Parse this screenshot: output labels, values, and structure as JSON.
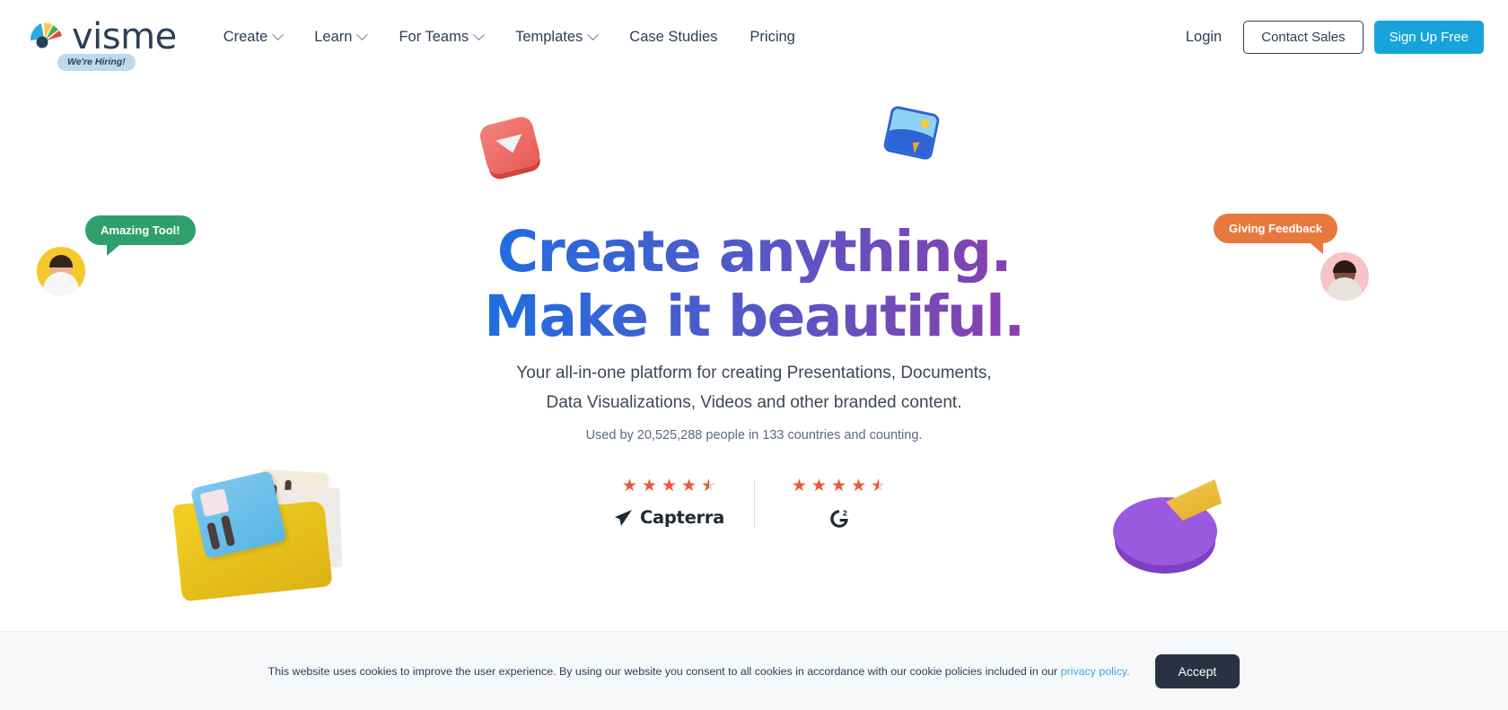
{
  "header": {
    "logo_text": "visme",
    "hiring_badge": "We're Hiring!",
    "nav": [
      {
        "label": "Create",
        "has_dropdown": true
      },
      {
        "label": "Learn",
        "has_dropdown": true
      },
      {
        "label": "For Teams",
        "has_dropdown": true
      },
      {
        "label": "Templates",
        "has_dropdown": true
      },
      {
        "label": "Case Studies",
        "has_dropdown": false
      },
      {
        "label": "Pricing",
        "has_dropdown": false
      }
    ],
    "login_label": "Login",
    "contact_sales_label": "Contact Sales",
    "signup_label": "Sign Up Free",
    "primary_color": "#17A4DC"
  },
  "hero": {
    "headline_line1": "Create anything.",
    "headline_line2": "Make it beautiful.",
    "subtitle_line1": "Your all-in-one platform for creating Presentations, Documents,",
    "subtitle_line2": "Data Visualizations, Videos and other branded content.",
    "used_by": "Used by 20,525,288 people in 133 countries and counting.",
    "gradient_start": "#243E96",
    "gradient_end": "#C9216B"
  },
  "ratings": [
    {
      "brand": "Capterra",
      "stars": 4.5,
      "star_color": "#F0553A",
      "logo": "capterra-cursor-icon"
    },
    {
      "brand": "G2",
      "stars": 4.5,
      "star_color": "#F0553A",
      "logo": "g2-icon"
    }
  ],
  "testimonials": [
    {
      "text": "Amazing Tool!",
      "color": "#2FA06C",
      "side": "left",
      "avatar": "avatar-male"
    },
    {
      "text": "Giving Feedback",
      "color": "#E8793E",
      "side": "right",
      "avatar": "avatar-female"
    }
  ],
  "decorations": [
    {
      "name": "video-play-tile-3d",
      "color": "#E65A55"
    },
    {
      "name": "image-media-tile-3d",
      "color": "#2D63D6"
    },
    {
      "name": "folder-documents-3d",
      "color": "#F2CE23"
    },
    {
      "name": "pie-chart-3d",
      "color": "#9B59E0"
    }
  ],
  "cookie": {
    "text_before": "This website uses cookies to improve the user experience. By using our website you consent to all cookies in accordance with our cookie policies included in our ",
    "link_text": "privacy policy.",
    "accept_label": "Accept"
  }
}
